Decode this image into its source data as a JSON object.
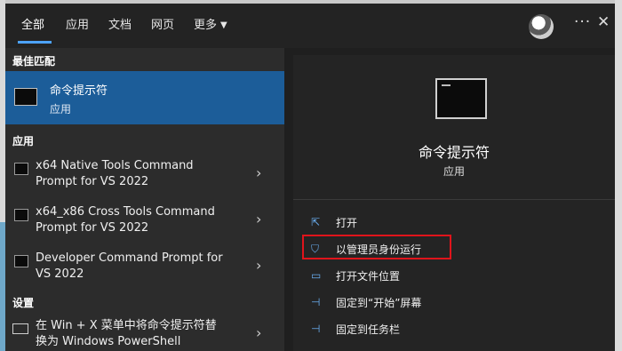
{
  "tabs": [
    {
      "label": "全部",
      "active": true
    },
    {
      "label": "应用"
    },
    {
      "label": "文档"
    },
    {
      "label": "网页"
    },
    {
      "label": "更多"
    }
  ],
  "topbar": {
    "more_glyph": "···",
    "close_glyph": "✕"
  },
  "best_match": {
    "header": "最佳匹配",
    "title": "命令提示符",
    "subtitle": "应用"
  },
  "apps": {
    "header": "应用",
    "items": [
      {
        "line1": "x64 Native Tools Command",
        "line2": "Prompt for VS 2022"
      },
      {
        "line1": "x64_x86 Cross Tools Command",
        "line2": "Prompt for VS 2022"
      },
      {
        "line1": "Developer Command Prompt for",
        "line2": "VS 2022"
      }
    ]
  },
  "settings": {
    "header": "设置",
    "items": [
      {
        "line1": "在 Win + X 菜单中将命令提示符替",
        "line2": "换为 Windows PowerShell"
      }
    ]
  },
  "detail": {
    "title": "命令提示符",
    "subtitle": "应用",
    "actions": [
      {
        "label": "打开",
        "icon": "open-icon"
      },
      {
        "label": "以管理员身份运行",
        "icon": "shield-icon"
      },
      {
        "label": "打开文件位置",
        "icon": "folder-icon"
      },
      {
        "label": "固定到“开始”屏幕",
        "icon": "pin-icon"
      },
      {
        "label": "固定到任务栏",
        "icon": "pin-icon"
      }
    ]
  },
  "colors": {
    "accent": "#4da3ff",
    "selection": "#1c5d99",
    "highlight_box": "#e0141b"
  }
}
